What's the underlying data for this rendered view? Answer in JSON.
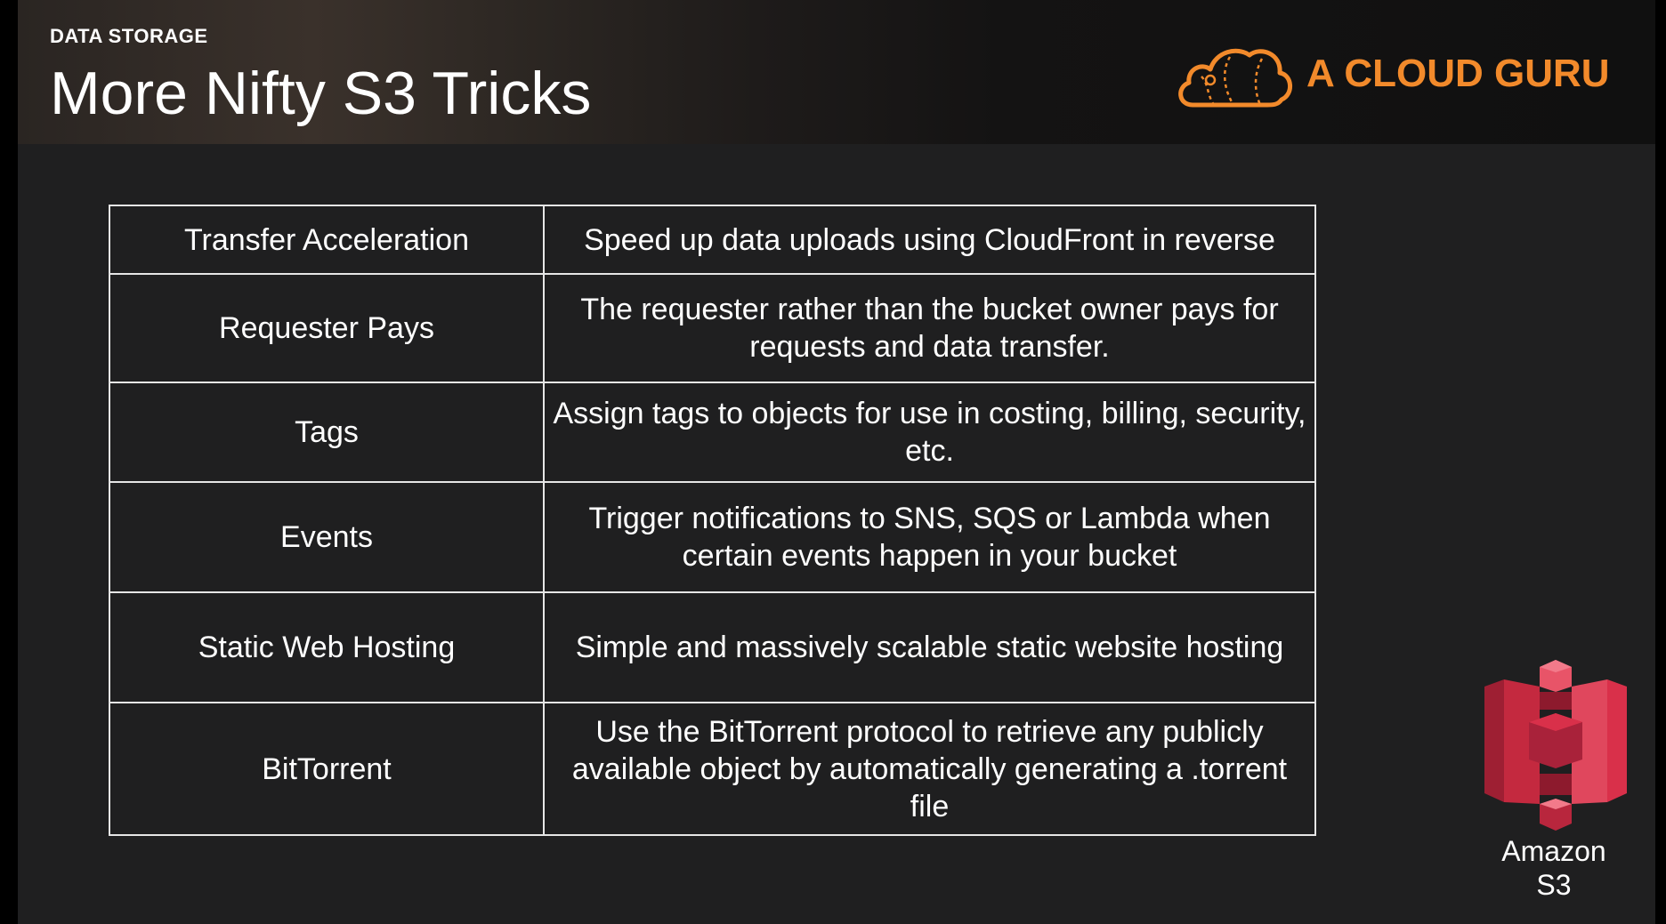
{
  "header": {
    "section_label": "DATA STORAGE",
    "title": "More Nifty S3 Tricks",
    "brand_name": "A CLOUD GURU",
    "brand_icon": "cloud-icon",
    "brand_color": "#f28a2b"
  },
  "table": {
    "rows": [
      {
        "feature": "Transfer Acceleration",
        "description": "Speed up data uploads using CloudFront in reverse"
      },
      {
        "feature": "Requester Pays",
        "description": "The requester rather than the bucket owner pays for requests and data transfer."
      },
      {
        "feature": "Tags",
        "description": "Assign tags to objects for use in costing, billing, security, etc."
      },
      {
        "feature": "Events",
        "description": "Trigger notifications to SNS, SQS or Lambda when certain events happen in your bucket"
      },
      {
        "feature": "Static Web Hosting",
        "description": "Simple and massively scalable static website hosting"
      },
      {
        "feature": "BitTorrent",
        "description": "Use the BitTorrent protocol to retrieve any publicly available object by automatically generating a .torrent file"
      }
    ]
  },
  "service": {
    "icon": "amazon-s3-icon",
    "label_line1": "Amazon",
    "label_line2": "S3",
    "color": "#d9304a"
  }
}
